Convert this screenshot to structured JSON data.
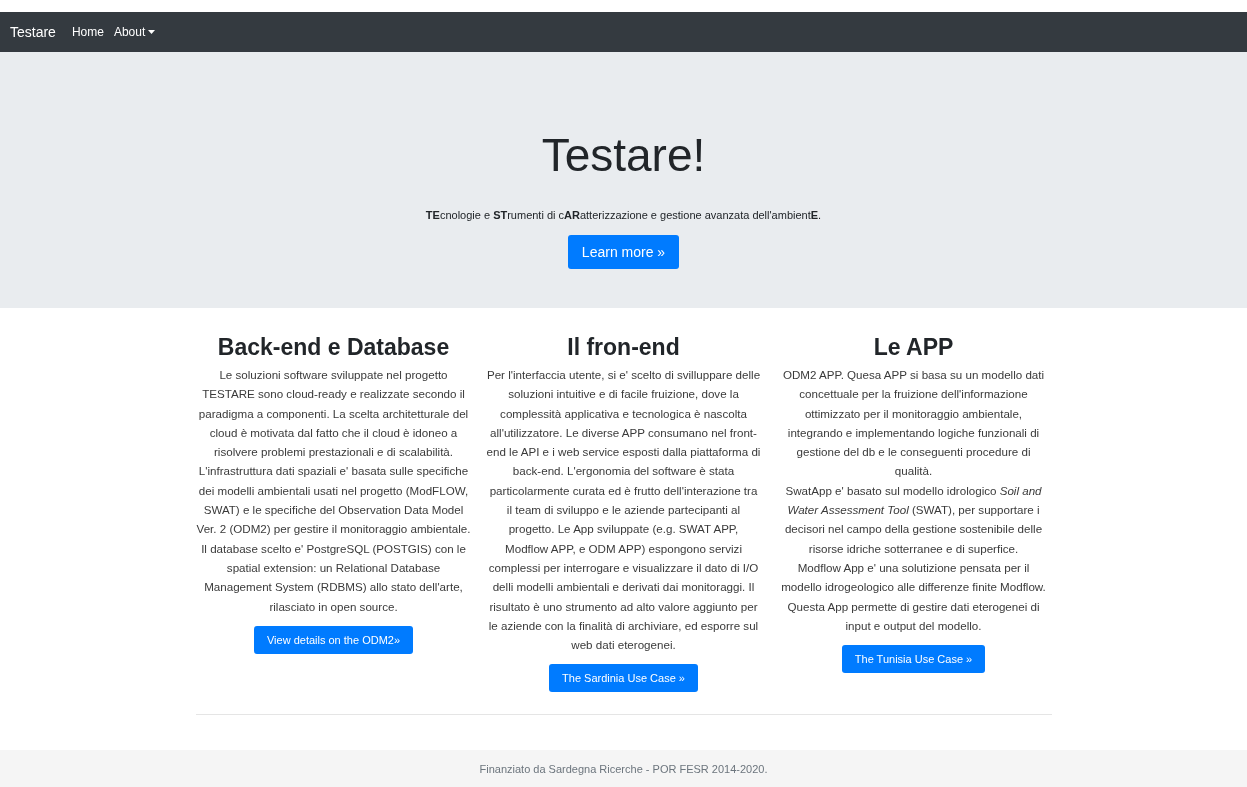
{
  "navbar": {
    "brand": "Testare",
    "links": [
      {
        "label": "Home",
        "dropdown": false
      },
      {
        "label": "About",
        "dropdown": true
      }
    ]
  },
  "hero": {
    "title": "Testare!",
    "subtitle": "**TE**cnologie e **ST**rumenti di c**AR**atterizzazione e gestione avanzata dell'ambient**E**.",
    "button": "Learn more »"
  },
  "columns": [
    {
      "heading": "Back-end e Database",
      "paragraphs": [
        "Le soluzioni software sviluppate nel progetto TESTARE sono cloud-ready e realizzate secondo il paradigma a componenti. La scelta architetturale del cloud è motivata dal fatto che il cloud è idoneo a risolvere problemi prestazionali e di scalabilità. L'infrastruttura dati spaziali e' basata sulle specifiche dei modelli ambientali usati nel progetto (ModFLOW, SWAT) e le specifiche del Observation Data Model Ver. 2 (ODM2) per gestire il monitoraggio ambientale. Il database scelto e' PostgreSQL (POSTGIS) con le spatial extension: un Relational Database Management System (RDBMS) allo stato dell'arte, rilasciato in open source."
      ],
      "button": "View details on the ODM2»"
    },
    {
      "heading": "Il fron-end",
      "paragraphs": [
        "Per l'interfaccia utente, si e' scelto di svilluppare delle soluzioni intuitive e di facile fruizione, dove la complessità applicativa e tecnologica è nascolta all'utilizzatore. Le diverse APP consumano nel front-end le API e i web service esposti dalla piattaforma di back-end. L'ergonomia del software è stata particolarmente curata ed è frutto dell'interazione tra il team di sviluppo e le aziende partecipanti al progetto. Le App sviluppate (e.g. SWAT APP, Modflow APP, e ODM APP) espongono servizi complessi per interrogare e visualizzare il dato di I/O delli modelli ambientali e derivati dai monitoraggi. Il risultato è uno strumento ad alto valore aggiunto per le aziende con la finalità di archiviare, ed esporre sul web dati eterogenei."
      ],
      "button": "The Sardinia Use Case »"
    },
    {
      "heading": "Le APP",
      "paragraphs": [
        "ODM2 APP. Quesa APP si basa su un modello dati concettuale per la fruizione dell'informazione ottimizzato per il monitoraggio ambientale, integrando e implementando logiche funzionali di gestione del db e le conseguenti procedure di qualità.",
        "SwatApp e' basato sul modello idrologico *Soil and Water Assessment Tool* (SWAT), per supportare i decisori nel campo della gestione sostenibile delle risorse idriche sotterranee e di superfice.",
        "Modflow App e' una solutizione pensata per il modello idrogeologico alle differenze finite Modflow. Questa App permette di gestire dati eterogenei di input e output del modello."
      ],
      "button": "The Tunisia Use Case »"
    }
  ],
  "footer": "Finanziato da Sardegna Ricerche - POR FESR 2014-2020."
}
